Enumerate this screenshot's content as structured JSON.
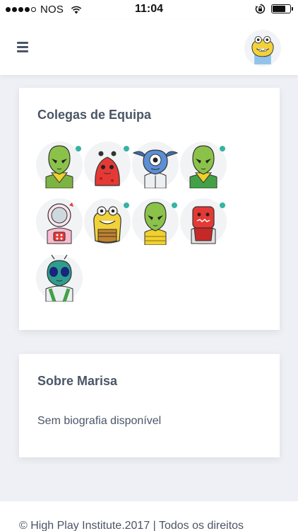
{
  "status_bar": {
    "carrier": "NOS",
    "time": "11:04",
    "signal_bars_filled": 4,
    "signal_bars_total": 5,
    "battery_level": 0.75,
    "icons": [
      "wifi-icon",
      "rotation-lock-icon",
      "battery-icon"
    ]
  },
  "header": {
    "menu_icon": "hamburger-icon",
    "avatar_icon": "yellow-monster-avatar"
  },
  "team": {
    "title": "Colegas de Equipa",
    "members": [
      {
        "avatar": "green-alien",
        "online": true
      },
      {
        "avatar": "red-blob-monster",
        "online": true
      },
      {
        "avatar": "blue-cyclops",
        "online": false
      },
      {
        "avatar": "green-alien",
        "online": true
      },
      {
        "avatar": "astronaut",
        "online": false
      },
      {
        "avatar": "yellow-monster",
        "online": true
      },
      {
        "avatar": "green-alien",
        "online": true
      },
      {
        "avatar": "red-monster",
        "online": true
      },
      {
        "avatar": "green-insect",
        "online": false
      }
    ]
  },
  "about": {
    "title": "Sobre Marisa",
    "bio": "Sem biografia disponível"
  },
  "footer": {
    "text": "© High Play Institute.2017 | Todos os direitos"
  },
  "colors": {
    "accent_online": "#37b3a3",
    "text": "#4a5666",
    "background": "#eef0f5"
  }
}
